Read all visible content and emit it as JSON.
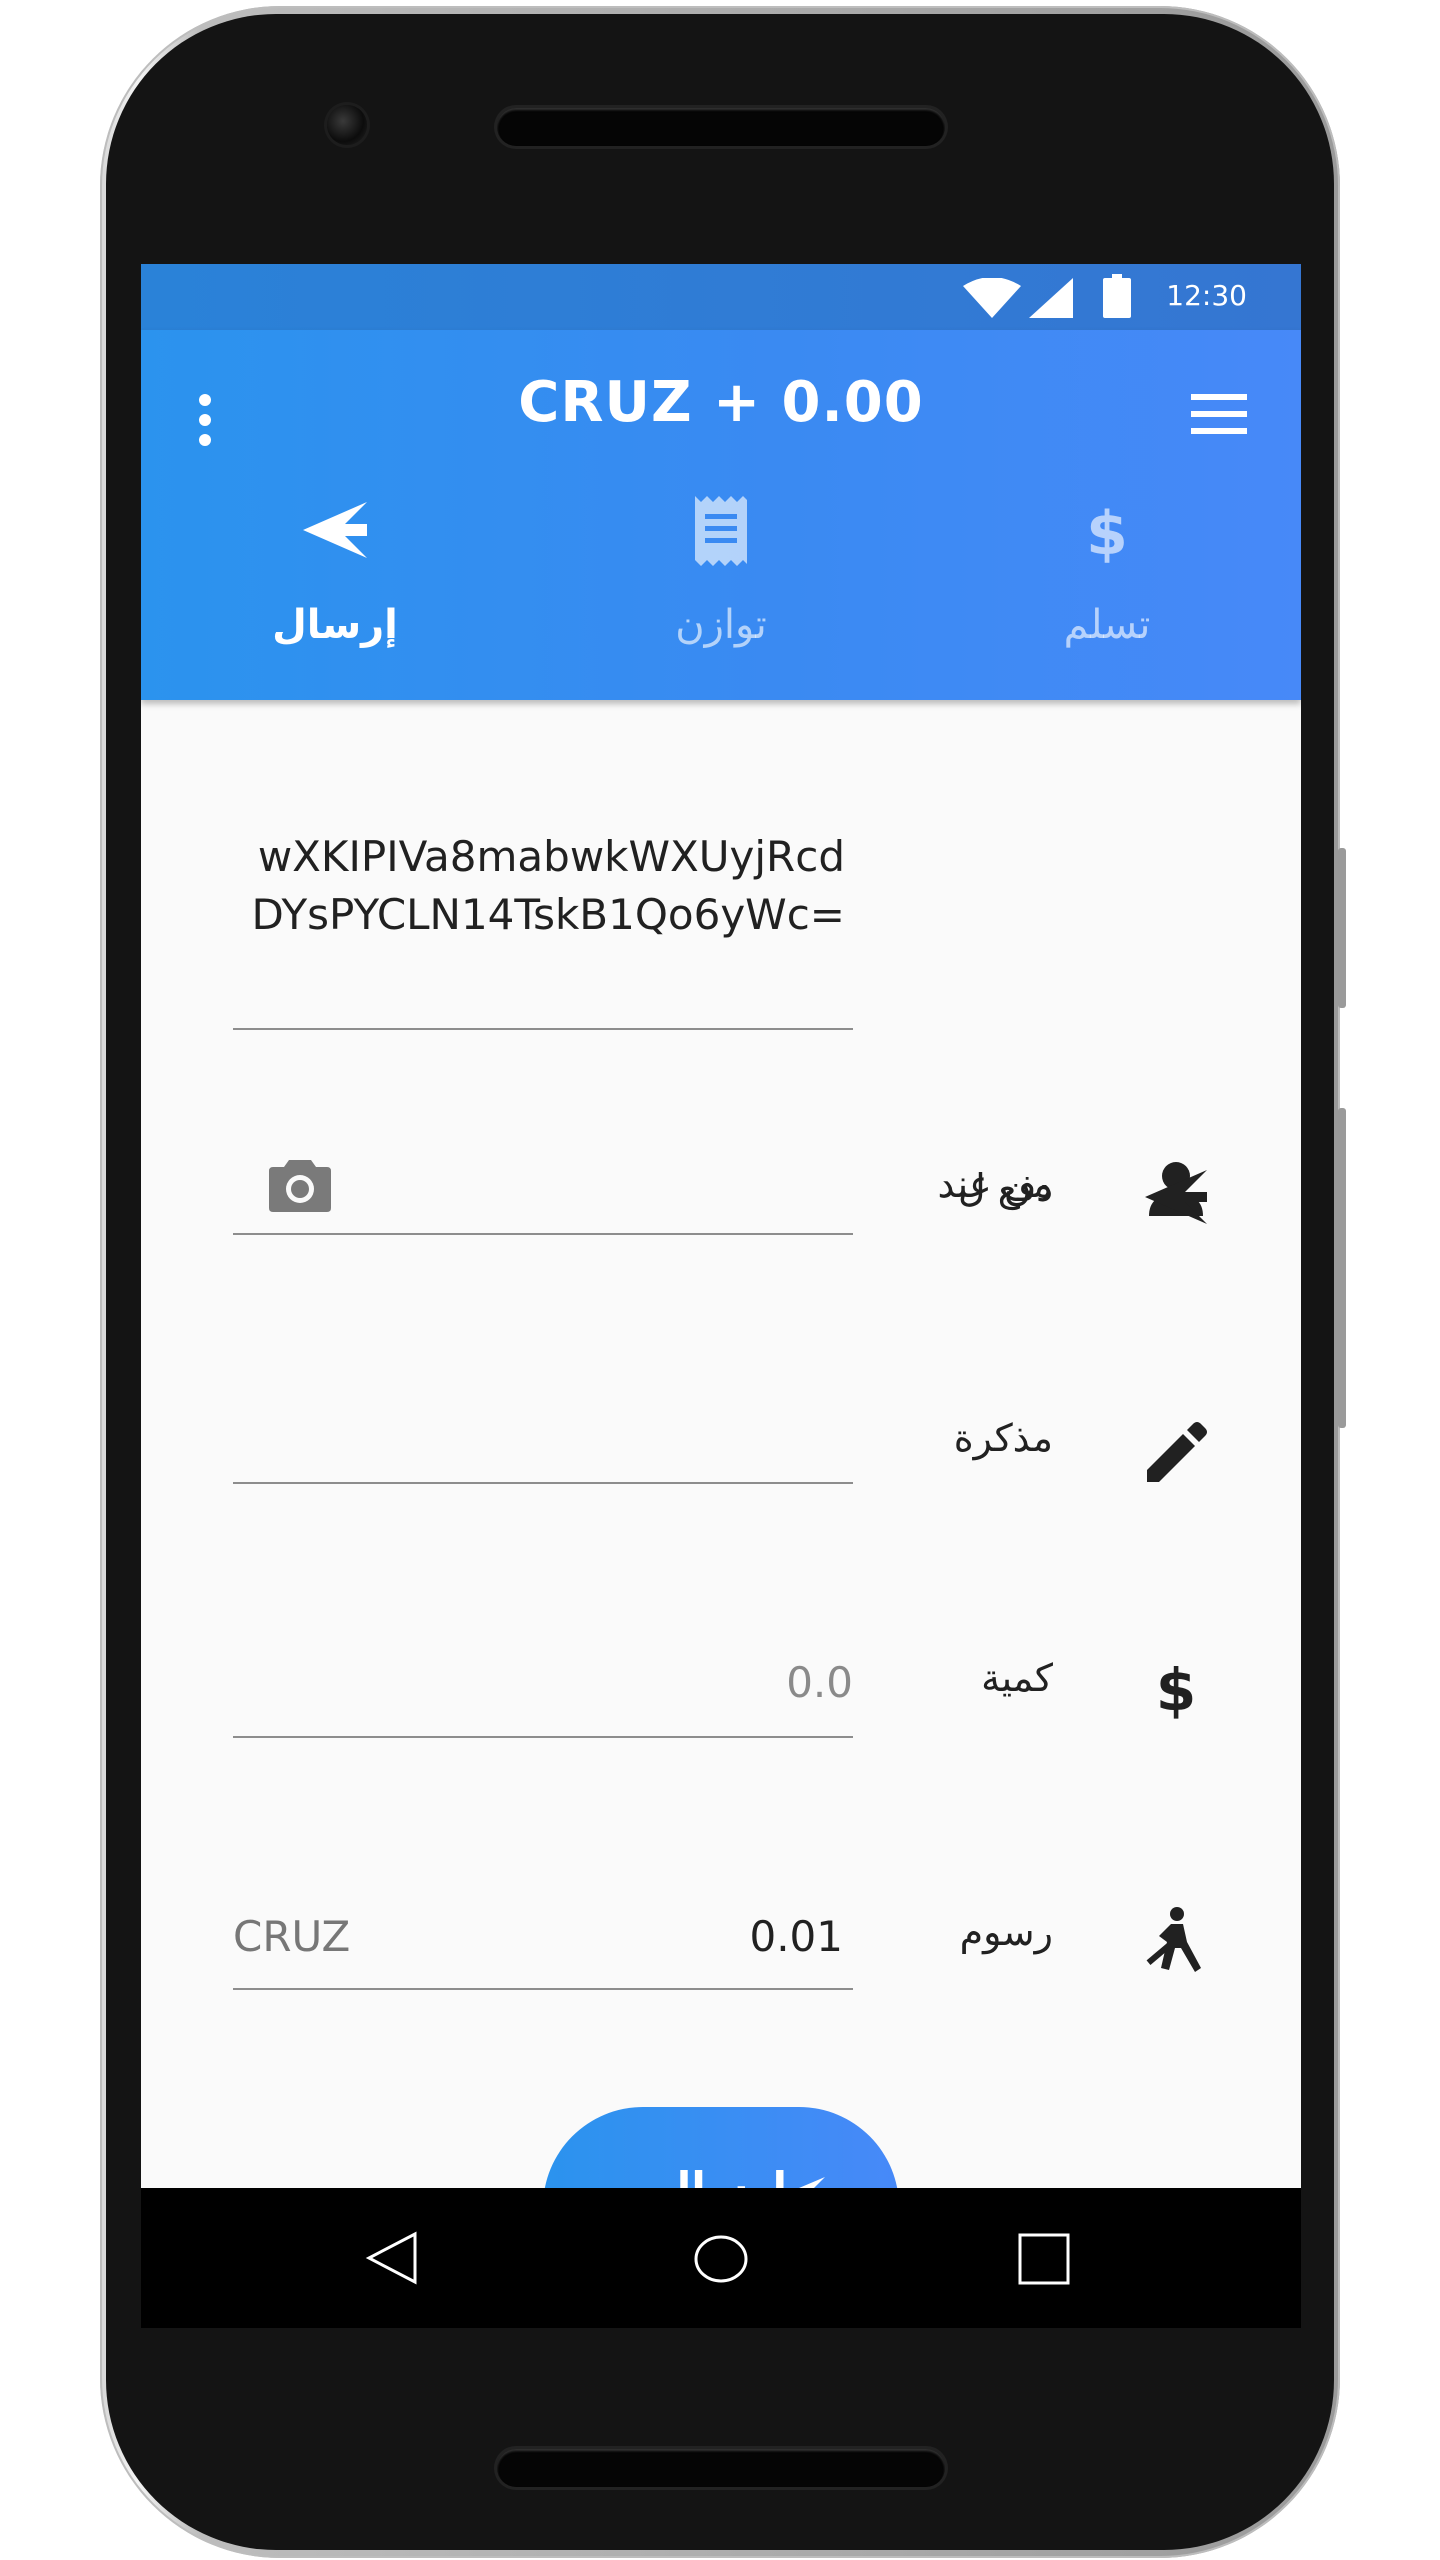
{
  "status_bar": {
    "time": "12:30"
  },
  "app_bar": {
    "title": "CRUZ + 0.00",
    "overflow_icon": "more-vert-icon",
    "menu_icon": "menu-icon"
  },
  "tabs": [
    {
      "label": "إرسال",
      "icon": "send-icon",
      "active": true
    },
    {
      "label": "توازن",
      "icon": "receipt-icon",
      "active": false
    },
    {
      "label": "تسلم",
      "icon": "dollar-icon",
      "active": false
    }
  ],
  "form": {
    "from": {
      "label": "من عند",
      "icon": "person-icon",
      "value": "wXKIPIVa8mabwkWXUyjRcdDYsPYCLN14TskB1Qo6yWc="
    },
    "pay_to": {
      "label": "دفع ل",
      "icon": "send-icon",
      "camera_icon": "camera-icon"
    },
    "memo": {
      "label": "مذكرة",
      "icon": "pencil-icon"
    },
    "amount": {
      "label": "كمية",
      "icon": "dollar-icon",
      "placeholder": "0.0"
    },
    "fee": {
      "label": "رسوم",
      "icon": "fee-icon",
      "value": "0.01",
      "unit": "CRUZ"
    }
  },
  "send_button": {
    "label": "إرسال",
    "icon": "send-icon"
  },
  "colors": {
    "primary": "#3a8af2",
    "primary_dark": "#2a82d8",
    "background": "#fafafa",
    "text": "#212121"
  }
}
